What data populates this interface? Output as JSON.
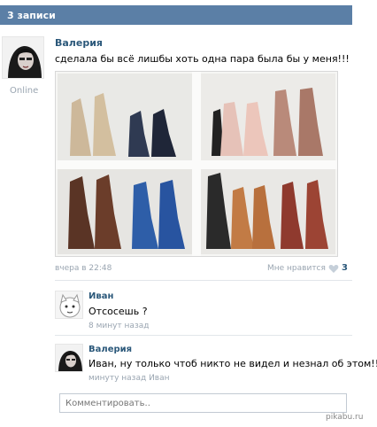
{
  "header": {
    "title": "3 записи"
  },
  "post": {
    "author": "Валерия",
    "status": "Online",
    "text": "сделала бы всё лишбы хоть одна пара была бы у меня!!!",
    "time": "вчера в 22:48",
    "like_label": "Мне нравится",
    "like_count": "3"
  },
  "comments": [
    {
      "author": "Иван",
      "text": "Отсосешь ?",
      "time": "8 минут назад"
    },
    {
      "author": "Валерия",
      "text": "Иван, ну только чтоб никто не видел и незнал об этом!!!",
      "time": "минуту назад Иван"
    }
  ],
  "comment_box": {
    "placeholder": "Комментировать.."
  },
  "watermark": "pikabu.ru",
  "colors": {
    "header": "#5b7fa6",
    "link": "#2b587a",
    "muted": "#9aa5b1"
  },
  "icons": {
    "like": "heart-icon"
  }
}
